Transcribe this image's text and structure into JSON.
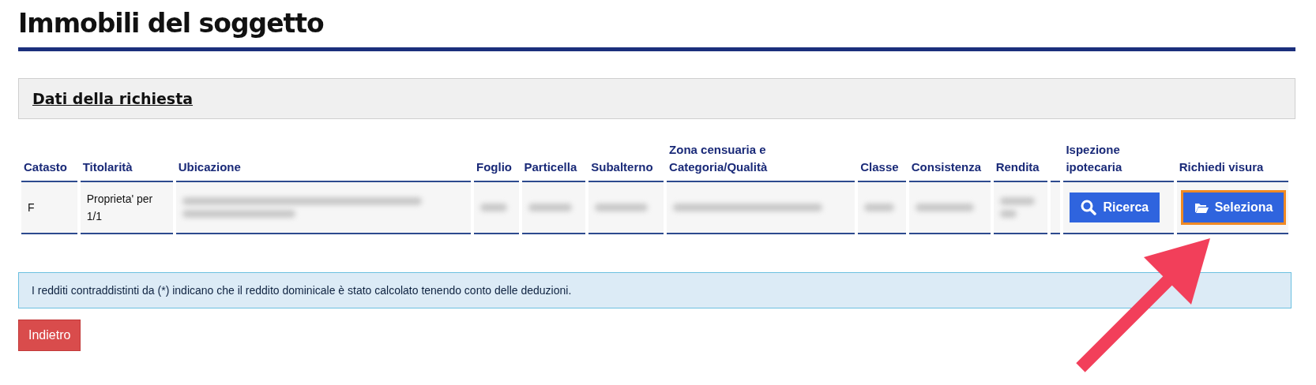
{
  "title": "Immobili del soggetto",
  "request_panel": {
    "title": "Dati della richiesta"
  },
  "table": {
    "columns": [
      "Catasto",
      "Titolarità",
      "Ubicazione",
      "Foglio",
      "Particella",
      "Subalterno",
      "Zona censuaria e Categoria/Qualità",
      "Classe",
      "Consistenza",
      "Rendita",
      "",
      "Ispezione ipotecaria",
      "Richiedi visura"
    ],
    "rows": [
      {
        "cells": [
          {
            "kind": "text",
            "text": "F"
          },
          {
            "kind": "text",
            "text": "Proprieta' per 1/1"
          },
          {
            "kind": "blurred"
          },
          {
            "kind": "blurred"
          },
          {
            "kind": "blurred"
          },
          {
            "kind": "blurred"
          },
          {
            "kind": "blurred"
          },
          {
            "kind": "blurred"
          },
          {
            "kind": "blurred"
          },
          {
            "kind": "blurred"
          },
          {
            "kind": "empty"
          },
          {
            "kind": "search",
            "label": "Ricerca",
            "highlighted": false
          },
          {
            "kind": "select",
            "label": "Seleziona",
            "highlighted": true
          }
        ]
      }
    ]
  },
  "info": "I redditi contraddistinti da (*) indicano che il reddito dominicale è stato calcolato tenendo conto delle deduzioni.",
  "back_button": "Indietro",
  "annotation": {
    "kind": "arrow"
  }
}
